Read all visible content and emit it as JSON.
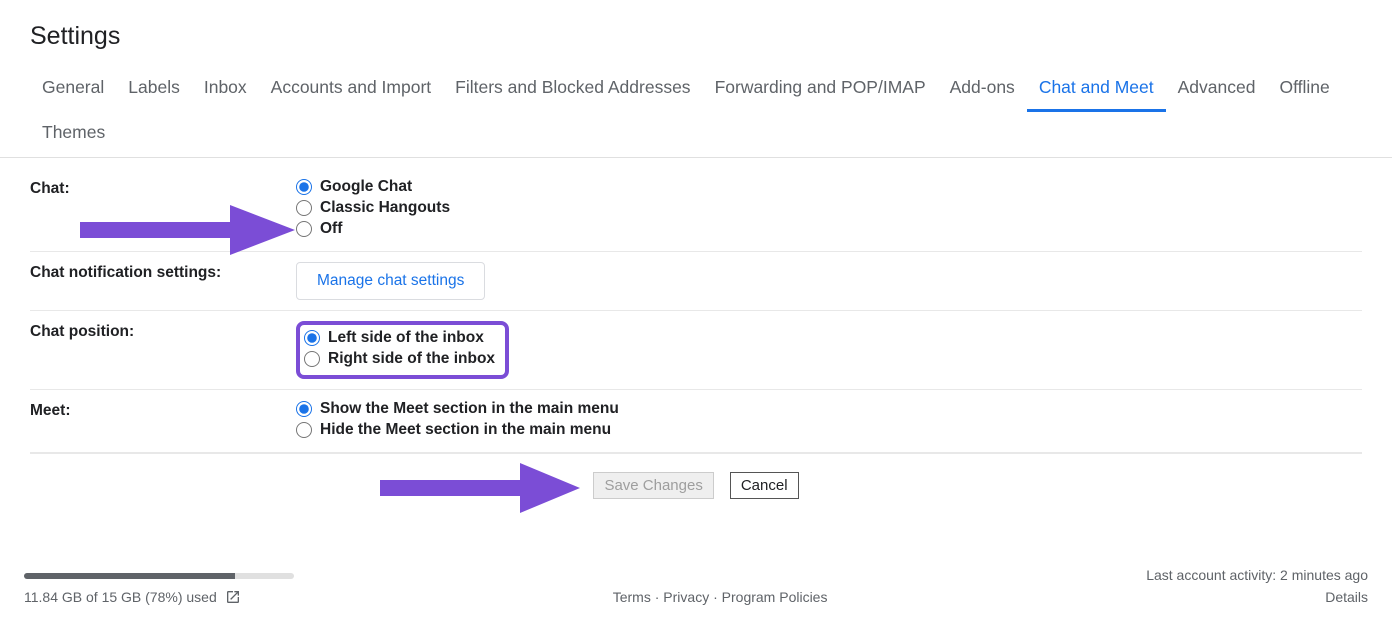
{
  "title": "Settings",
  "tabs": {
    "general": "General",
    "labels": "Labels",
    "inbox": "Inbox",
    "accounts": "Accounts and Import",
    "filters": "Filters and Blocked Addresses",
    "forwarding": "Forwarding and POP/IMAP",
    "addons": "Add-ons",
    "chatmeet": "Chat and Meet",
    "advanced": "Advanced",
    "offline": "Offline",
    "themes": "Themes"
  },
  "sections": {
    "chat": {
      "label": "Chat:",
      "options": {
        "google": "Google Chat",
        "classic": "Classic Hangouts",
        "off": "Off"
      }
    },
    "notif": {
      "label": "Chat notification settings:",
      "button": "Manage chat settings"
    },
    "position": {
      "label": "Chat position:",
      "options": {
        "left": "Left side of the inbox",
        "right": "Right side of the inbox"
      }
    },
    "meet": {
      "label": "Meet:",
      "options": {
        "show": "Show the Meet section in the main menu",
        "hide": "Hide the Meet section in the main menu"
      }
    }
  },
  "buttons": {
    "save": "Save Changes",
    "cancel": "Cancel"
  },
  "footer": {
    "storage_text": "11.84 GB of 15 GB (78%) used",
    "terms": "Terms",
    "privacy": "Privacy",
    "policies": "Program Policies",
    "activity": "Last account activity: 2 minutes ago",
    "details": "Details"
  }
}
